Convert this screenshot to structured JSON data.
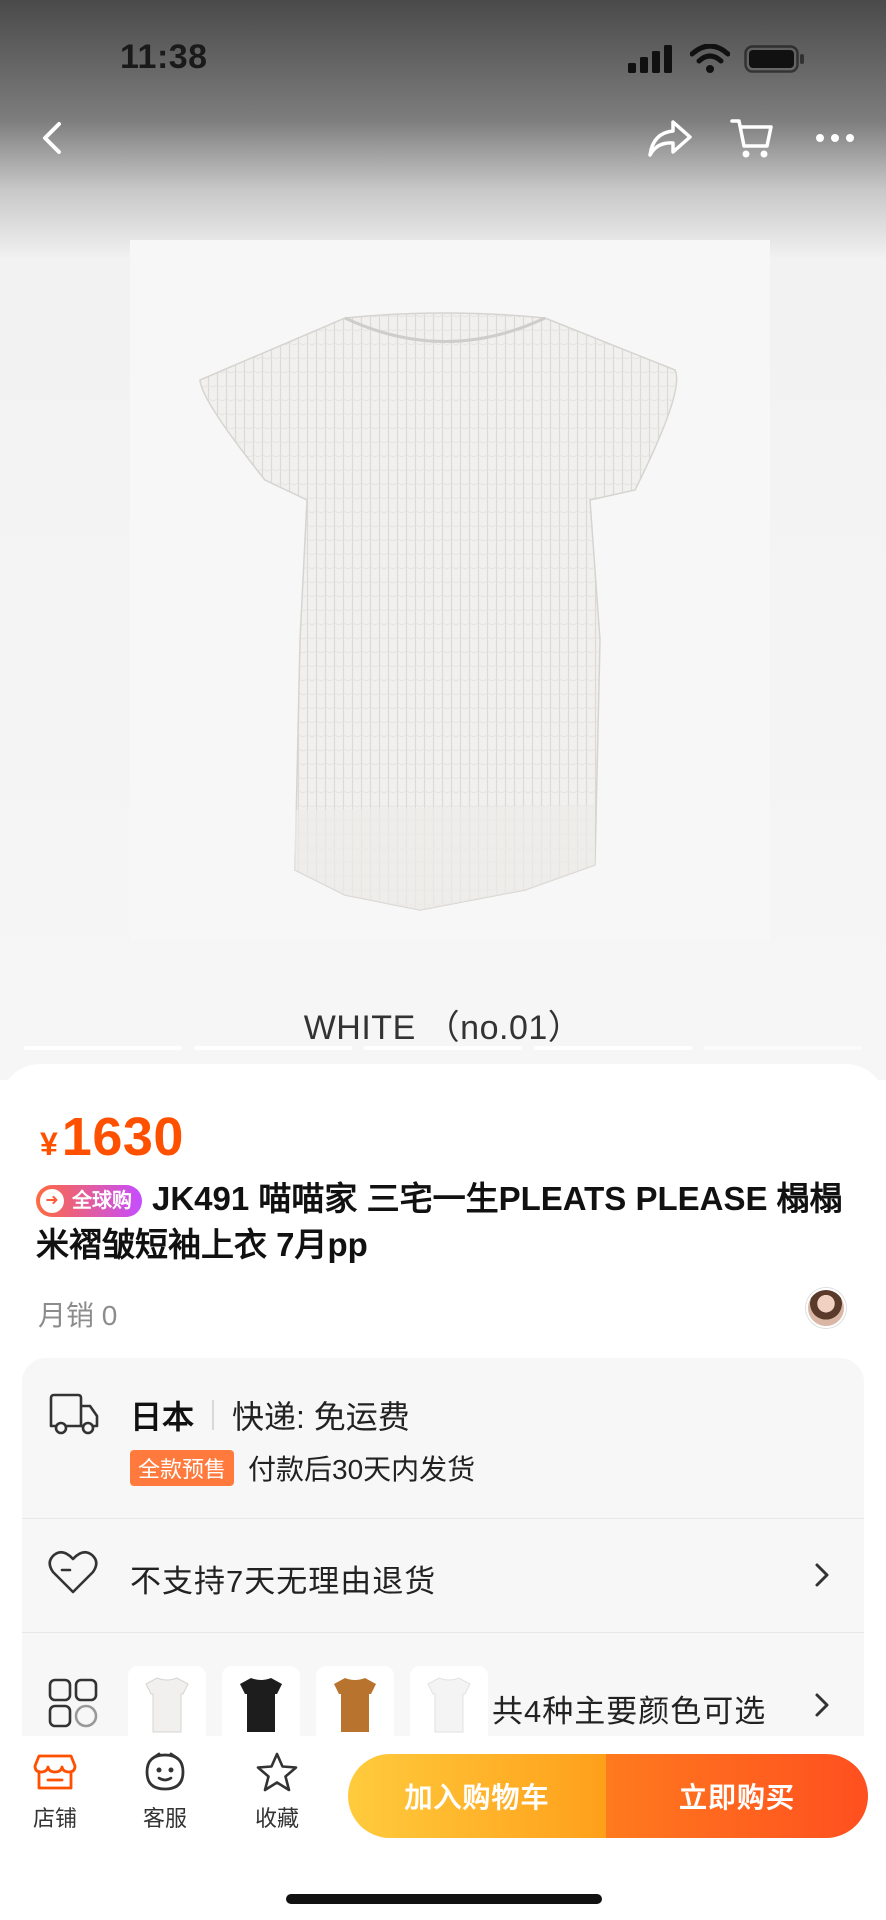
{
  "status_bar": {
    "time": "11:38",
    "icons": [
      "signal-icon",
      "wifi-icon",
      "battery-icon"
    ]
  },
  "nav": {
    "back_icon": "chevron-left-icon",
    "share_icon": "share-icon",
    "cart_icon": "cart-icon",
    "more_icon": "more-dots-icon"
  },
  "gallery": {
    "caption": "WHITE （no.01）",
    "indicator_count": 5,
    "active_indicator": 0
  },
  "product": {
    "currency_symbol": "¥",
    "price": "1630",
    "badge": "全球购",
    "title": "JK491 喵喵家 三宅一生PLEATS PLEASE 榻榻米褶皱短袖上衣 7月pp",
    "sales": "月销 0"
  },
  "shipping": {
    "origin": "日本",
    "method": "快递: 免运费",
    "presale_tag": "全款预售",
    "delivery_note": "付款后30天内发货"
  },
  "returns": {
    "text": "不支持7天无理由退货"
  },
  "colors": {
    "text": "共4种主要颜色可选",
    "swatches": [
      "white",
      "black",
      "brown",
      "white"
    ]
  },
  "bottom_bar": {
    "shop_label": "店铺",
    "service_label": "客服",
    "favorite_label": "收藏",
    "add_to_cart": "加入购物车",
    "buy_now": "立即购买"
  },
  "theme": {
    "price_color": "#ff5000",
    "cart_button_color": "#ffb02e",
    "buy_button_color": "#ff5a1f"
  }
}
